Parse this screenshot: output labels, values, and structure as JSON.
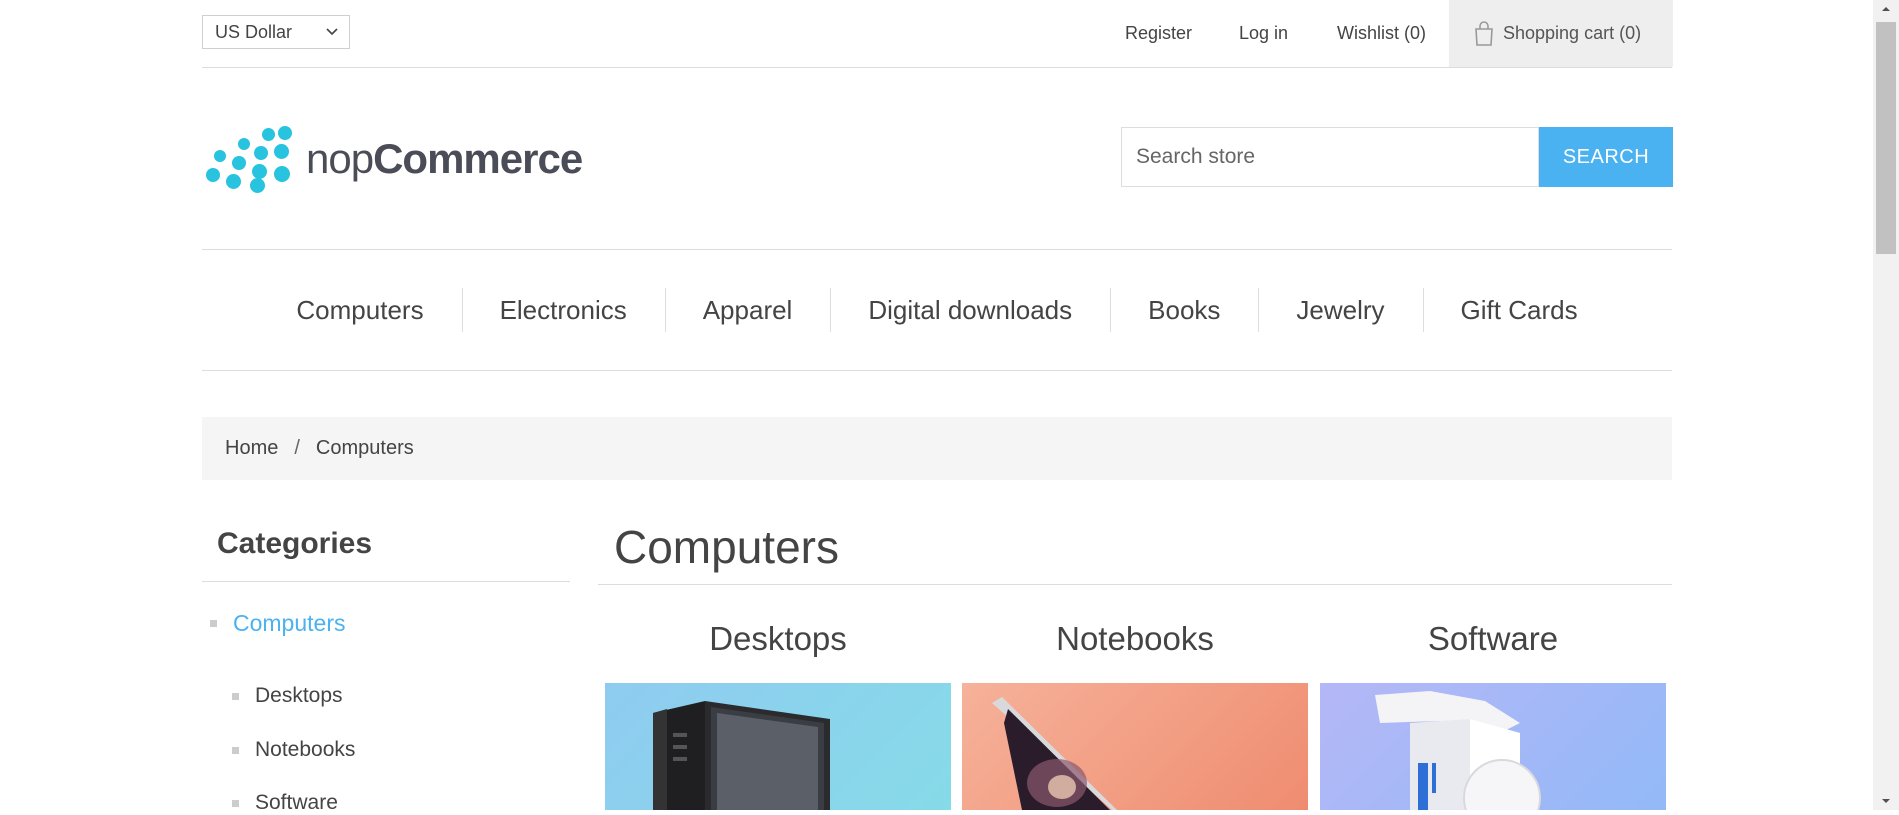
{
  "header": {
    "currency": "US Dollar",
    "links": {
      "register": "Register",
      "login": "Log in",
      "wishlist": "Wishlist (0)",
      "cart": "Shopping cart (0)"
    }
  },
  "logo": {
    "prefix": "nop",
    "suffix": "Commerce"
  },
  "search": {
    "placeholder": "Search store",
    "button": "SEARCH"
  },
  "menu": {
    "items": [
      "Computers",
      "Electronics",
      "Apparel",
      "Digital downloads",
      "Books",
      "Jewelry",
      "Gift Cards"
    ]
  },
  "breadcrumb": {
    "home": "Home",
    "separator": "/",
    "current": "Computers"
  },
  "sidebar": {
    "title": "Categories",
    "active": "Computers",
    "subitems": [
      "Desktops",
      "Notebooks",
      "Software"
    ]
  },
  "main": {
    "title": "Computers",
    "categories": [
      "Desktops",
      "Notebooks",
      "Software"
    ]
  },
  "colors": {
    "accent": "#4ab2f1",
    "logo": "#27c3df"
  }
}
